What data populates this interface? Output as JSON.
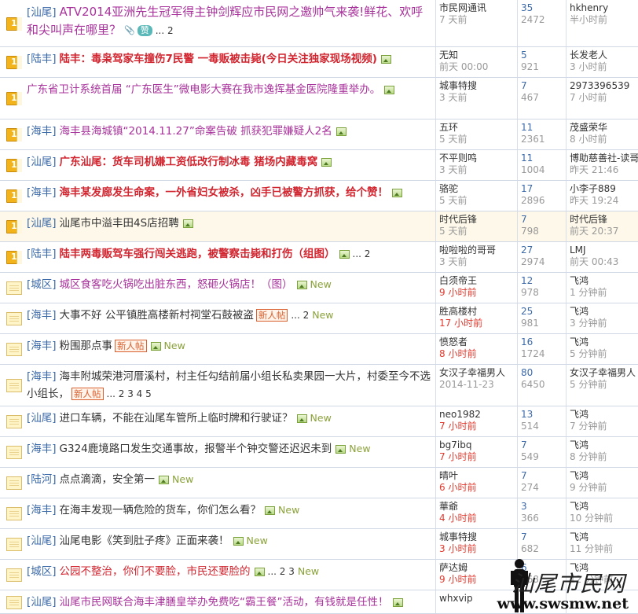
{
  "threads": [
    {
      "icon": "hot",
      "forum": "[汕尾]",
      "title": "ATV2014亚洲先生冠军得主钟剑辉应市民网之邀帅气来袭!鲜花、欢呼和尖叫声在哪里？",
      "style": "purple big",
      "attach": true,
      "zan": "赞",
      "pages": "... 2",
      "author": "市民网通讯",
      "date": "7 天前",
      "dateRed": false,
      "replies": "35",
      "views": "2472",
      "lastuser": "hkhenry",
      "lastdate": "半小时前",
      "h": 60
    },
    {
      "icon": "hot",
      "forum": "[陆丰]",
      "title": "陆丰：毒枭驾家车撞伤7民警 一毒贩被击毙(今日关注独家现场视频)",
      "style": "red",
      "img": true,
      "author": "无知",
      "date": "前天 00:00",
      "replies": "5",
      "views": "921",
      "lastuser": "长发老人",
      "lastdate": "3 小时前",
      "h": 39
    },
    {
      "icon": "hot",
      "forum": "",
      "title": "广东省卫计系统首届 “广东医生”微电影大赛在我市逸挥基金医院隆重举办。",
      "style": "purple",
      "img": true,
      "author": "城事特搜",
      "date": "3 天前",
      "replies": "7",
      "views": "467",
      "lastuser": "2973396539",
      "lastdate": "7 小时前",
      "h": 53
    },
    {
      "icon": "hot",
      "forum": "[海丰]",
      "title": "海丰县海城镇“2014.11.27”命案告破 抓获犯罪嫌疑人2名",
      "style": "purple",
      "img": true,
      "author": "五环",
      "date": "5 天前",
      "replies": "11",
      "views": "2361",
      "lastuser": "茂盛荣华",
      "lastdate": "8 小时前",
      "h": 39
    },
    {
      "icon": "hot",
      "forum": "[汕尾]",
      "title": "广东汕尾：货车司机嫌工资低改行制冰毒 猪场内藏毒窝",
      "style": "red",
      "img": true,
      "author": "不平则鸣",
      "date": "3 天前",
      "replies": "11",
      "views": "1004",
      "lastuser": "博助慈善社-读哥",
      "lastdate": "昨天 21:46",
      "h": 39
    },
    {
      "icon": "hot",
      "forum": "[海丰]",
      "title": "海丰某发廊发生命案，一外省妇女被杀，凶手已被警方抓获，给个赞！",
      "style": "red",
      "img": true,
      "author": "骆驼",
      "date": "5 天前",
      "replies": "17",
      "views": "2896",
      "lastuser": "小李子889",
      "lastdate": "昨天 19:24",
      "h": 39
    },
    {
      "icon": "hot",
      "forum": "[汕尾]",
      "title": "汕尾市中溢丰田4S店招聘",
      "style": "",
      "img": true,
      "hl": true,
      "author": "时代后锋",
      "date": "5 天前",
      "replies": "7",
      "views": "798",
      "lastuser": "时代后锋",
      "lastdate": "前天 20:37",
      "h": 39
    },
    {
      "icon": "hot",
      "forum": "[陆丰]",
      "title": "陆丰两毒贩驾车强行闯关逃跑，被警察击毙和打伤（组图）",
      "style": "red",
      "img": true,
      "pages": "... 2",
      "author": "啦啦啦的哥哥",
      "date": "3 天前",
      "replies": "27",
      "views": "2974",
      "lastuser": "LMJ",
      "lastdate": "前天 00:43",
      "h": 39
    },
    {
      "icon": "norm",
      "forum": "[城区]",
      "title": "城区食客吃火锅吃出脏东西，怒砸火锅店！（图）",
      "style": "purple",
      "img": true,
      "newtag": "New",
      "author": "白须帝王",
      "date": "9 小时前",
      "dateRed": true,
      "replies": "12",
      "views": "978",
      "lastuser": "飞鸿",
      "lastdate": "1 分钟前",
      "h": 39
    },
    {
      "icon": "norm",
      "forum": "[海丰]",
      "title": "大事不好 公平镇胜高楼新村祠堂石鼓被盗",
      "style": "",
      "newbadge": "新人帖",
      "pages": "... 2",
      "newtag": "New",
      "author": "胜高楼村",
      "date": "17 小时前",
      "dateRed": true,
      "replies": "25",
      "views": "981",
      "lastuser": "飞鸿",
      "lastdate": "3 分钟前",
      "h": 39
    },
    {
      "icon": "norm",
      "forum": "[海丰]",
      "title": "粉围那点事",
      "style": "",
      "newbadge": "新人帖",
      "img": true,
      "newtag": "New",
      "author": "愤怒者",
      "date": "8 小时前",
      "dateRed": true,
      "replies": "16",
      "views": "1724",
      "lastuser": "飞鸿",
      "lastdate": "5 分钟前",
      "h": 39
    },
    {
      "icon": "norm",
      "forum": "[海丰]",
      "title": "海丰附城荣港河厝溪村，村主任勾结前届小组长私卖果园一大片，村委至今不选小组长，",
      "style": "",
      "newbadge": "新人帖",
      "pages": "... 2 3 4 5",
      "author": "女汉子幸福男人",
      "date": "2014-11-23",
      "replies": "80",
      "views": "6450",
      "lastuser": "女汉子幸福男人",
      "lastdate": "5 分钟前",
      "h": 53
    },
    {
      "icon": "norm",
      "forum": "[汕尾]",
      "title": "进口车辆，不能在汕尾车管所上临时牌和行驶证？",
      "style": "",
      "img": true,
      "newtag": "New",
      "author": "neo1982",
      "date": "7 小时前",
      "dateRed": true,
      "replies": "13",
      "views": "514",
      "lastuser": "飞鸿",
      "lastdate": "7 分钟前",
      "h": 39
    },
    {
      "icon": "norm",
      "forum": "[海丰]",
      "title": "G324鹿境路口发生交通事故，报警半个钟交警还迟迟未到",
      "style": "",
      "img": true,
      "newtag": "New",
      "author": "bg7ibq",
      "date": "7 小时前",
      "dateRed": true,
      "replies": "7",
      "views": "549",
      "lastuser": "飞鸿",
      "lastdate": "8 分钟前",
      "h": 39
    },
    {
      "icon": "norm",
      "forum": "[陆河]",
      "title": "点点滴滴，安全第一",
      "style": "",
      "img": true,
      "newtag": "New",
      "author": "晴叶",
      "date": "6 小时前",
      "dateRed": true,
      "replies": "7",
      "views": "274",
      "lastuser": "飞鸿",
      "lastdate": "9 分钟前",
      "h": 39
    },
    {
      "icon": "norm",
      "forum": "[海丰]",
      "title": "在海丰发现一辆危险的货车，你们怎么看？",
      "style": "",
      "img": true,
      "newtag": "New",
      "author": "華爺",
      "date": "4 小时前",
      "dateRed": true,
      "replies": "3",
      "views": "366",
      "lastuser": "飞鸿",
      "lastdate": "10 分钟前",
      "h": 39
    },
    {
      "icon": "norm",
      "forum": "[汕尾]",
      "title": "汕尾电影《笑到肚子疼》正面来袭！",
      "style": "",
      "img": true,
      "newtag": "New",
      "author": "城事特搜",
      "date": "3 小时前",
      "dateRed": true,
      "replies": "7",
      "views": "682",
      "lastuser": "飞鸿",
      "lastdate": "11 分钟前",
      "h": 39
    },
    {
      "icon": "norm",
      "forum": "[城区]",
      "title": "公园不整治，你们不要脸，市民还要脸的",
      "style": "red-normal",
      "img": true,
      "pages": "... 2 3",
      "newtag": "New",
      "author": "萨达姆",
      "date": "9 小时前",
      "dateRed": true,
      "replies": "6",
      "views": "168",
      "lastuser": "飞鸿",
      "lastdate": "12 分钟前",
      "h": 39
    },
    {
      "icon": "norm",
      "forum": "[汕尾]",
      "title": "汕尾市民网联合海丰津膳皇举办免费吃“霸王餐”活动，有钱就是任性！",
      "style": "purple",
      "img": true,
      "author": "whxvip",
      "date": "",
      "replies": "",
      "views": "",
      "lastuser": "",
      "lastdate": "",
      "h": 30
    }
  ],
  "watermark": {
    "logo": "汕尾市民网",
    "url": "www.swsmw.net"
  },
  "colors": {
    "link": "#3b69a8",
    "red": "#d1252f",
    "purple": "#a8329b",
    "newtag": "#8aa23a",
    "border": "#cfd8e4"
  }
}
